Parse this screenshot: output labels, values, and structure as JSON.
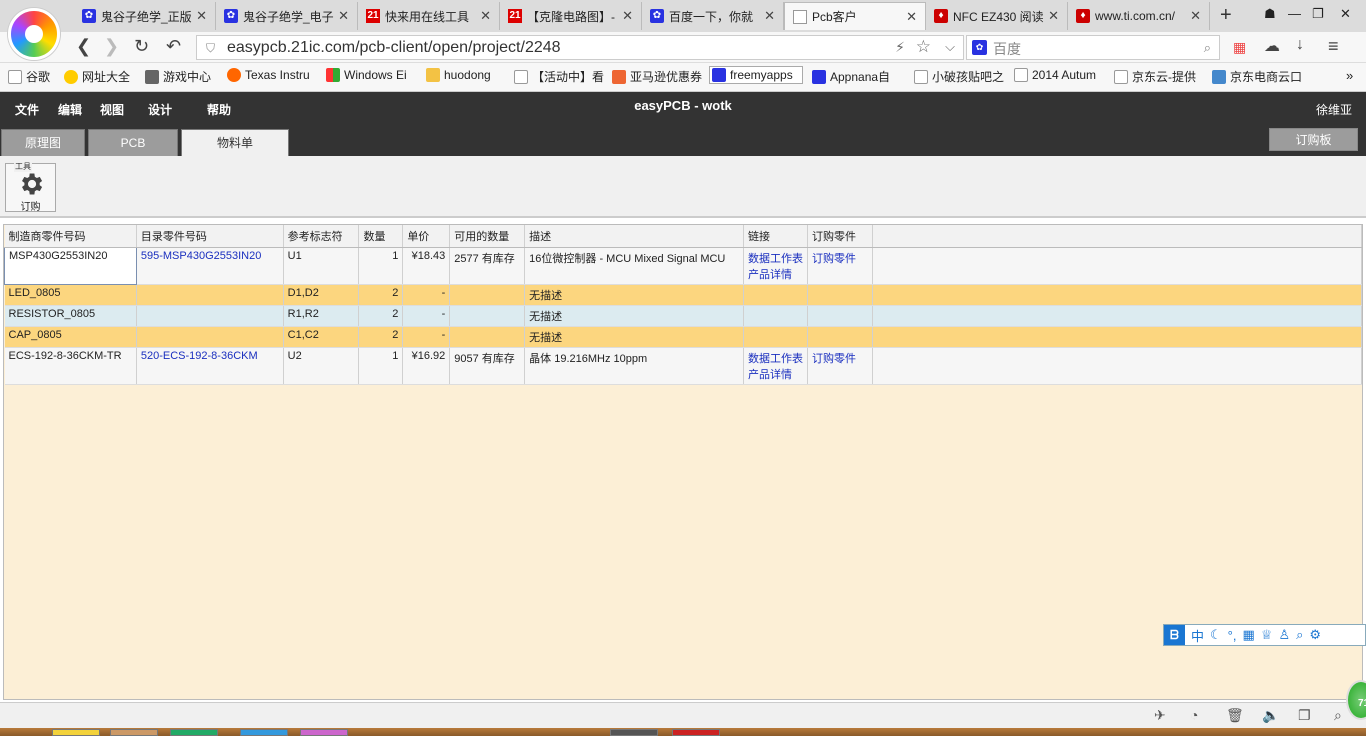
{
  "browser": {
    "tabs": [
      {
        "label": "鬼谷子绝学_正版",
        "icon": "baidu"
      },
      {
        "label": "鬼谷子绝学_电子",
        "icon": "baidu"
      },
      {
        "label": "快来用在线工具",
        "icon": "21ic"
      },
      {
        "label": "【克隆电路图】-",
        "icon": "21ic"
      },
      {
        "label": "百度一下，你就",
        "icon": "baidu"
      },
      {
        "label": "Pcb客户",
        "icon": "doc",
        "active": true
      },
      {
        "label": "NFC EZ430 阅读",
        "icon": "ti"
      },
      {
        "label": "www.ti.com.cn/",
        "icon": "ti"
      }
    ],
    "url": "easypcb.21ic.com/pcb-client/open/project/2248",
    "search_placeholder": "百度",
    "bookmarks": [
      "谷歌",
      "网址大全",
      "游戏中心",
      "Texas Instru",
      "Windows Ei",
      "huodong",
      "【活动中】看",
      "亚马逊优惠券",
      "freemyapps",
      "Appnana自",
      "小破孩贴吧之",
      "2014 Autum",
      "京东云-提供",
      "京东电商云口"
    ]
  },
  "app": {
    "menu": [
      "文件",
      "编辑",
      "视图",
      "设计",
      "帮助"
    ],
    "title": "easyPCB - wotk",
    "user": "徐维亚",
    "tabs": [
      "原理图",
      "PCB",
      "物料单"
    ],
    "order_board": "订购板",
    "toolbar": {
      "group_label": "工具",
      "order_label": "订购"
    }
  },
  "bom": {
    "columns": [
      "制造商零件号码",
      "目录零件号码",
      "参考标志符",
      "数量",
      "单价",
      "可用的数量",
      "描述",
      "链接",
      "订购零件"
    ],
    "rows": [
      {
        "mfr": "MSP430G2553IN20",
        "catalog": "595-MSP430G2553IN20",
        "ref": "U1",
        "qty": "1",
        "price": "¥18.43",
        "avail": "2577 有库存",
        "desc": "16位微控制器 - MCU Mixed Signal MCU",
        "link1": "数据工作表",
        "link2": "产品详情",
        "order": "订购零件",
        "style": "white"
      },
      {
        "mfr": "LED_0805",
        "catalog": "",
        "ref": "D1,D2",
        "qty": "2",
        "price": "-",
        "avail": "",
        "desc": "无描述",
        "link1": "",
        "link2": "",
        "order": "",
        "style": "orange"
      },
      {
        "mfr": "RESISTOR_0805",
        "catalog": "",
        "ref": "R1,R2",
        "qty": "2",
        "price": "-",
        "avail": "",
        "desc": "无描述",
        "link1": "",
        "link2": "",
        "order": "",
        "style": "blue"
      },
      {
        "mfr": "CAP_0805",
        "catalog": "",
        "ref": "C1,C2",
        "qty": "2",
        "price": "-",
        "avail": "",
        "desc": "无描述",
        "link1": "",
        "link2": "",
        "order": "",
        "style": "orange"
      },
      {
        "mfr": "ECS-192-8-36CKM-TR",
        "catalog": "520-ECS-192-8-36CKM",
        "ref": "U2",
        "qty": "1",
        "price": "¥16.92",
        "avail": "9057 有库存",
        "desc": "晶体 19.216MHz 10ppm",
        "link1": "数据工作表",
        "link2": "产品详情",
        "order": "订购零件",
        "style": "white"
      }
    ]
  },
  "ime": {
    "label": "中"
  },
  "badge": "71"
}
